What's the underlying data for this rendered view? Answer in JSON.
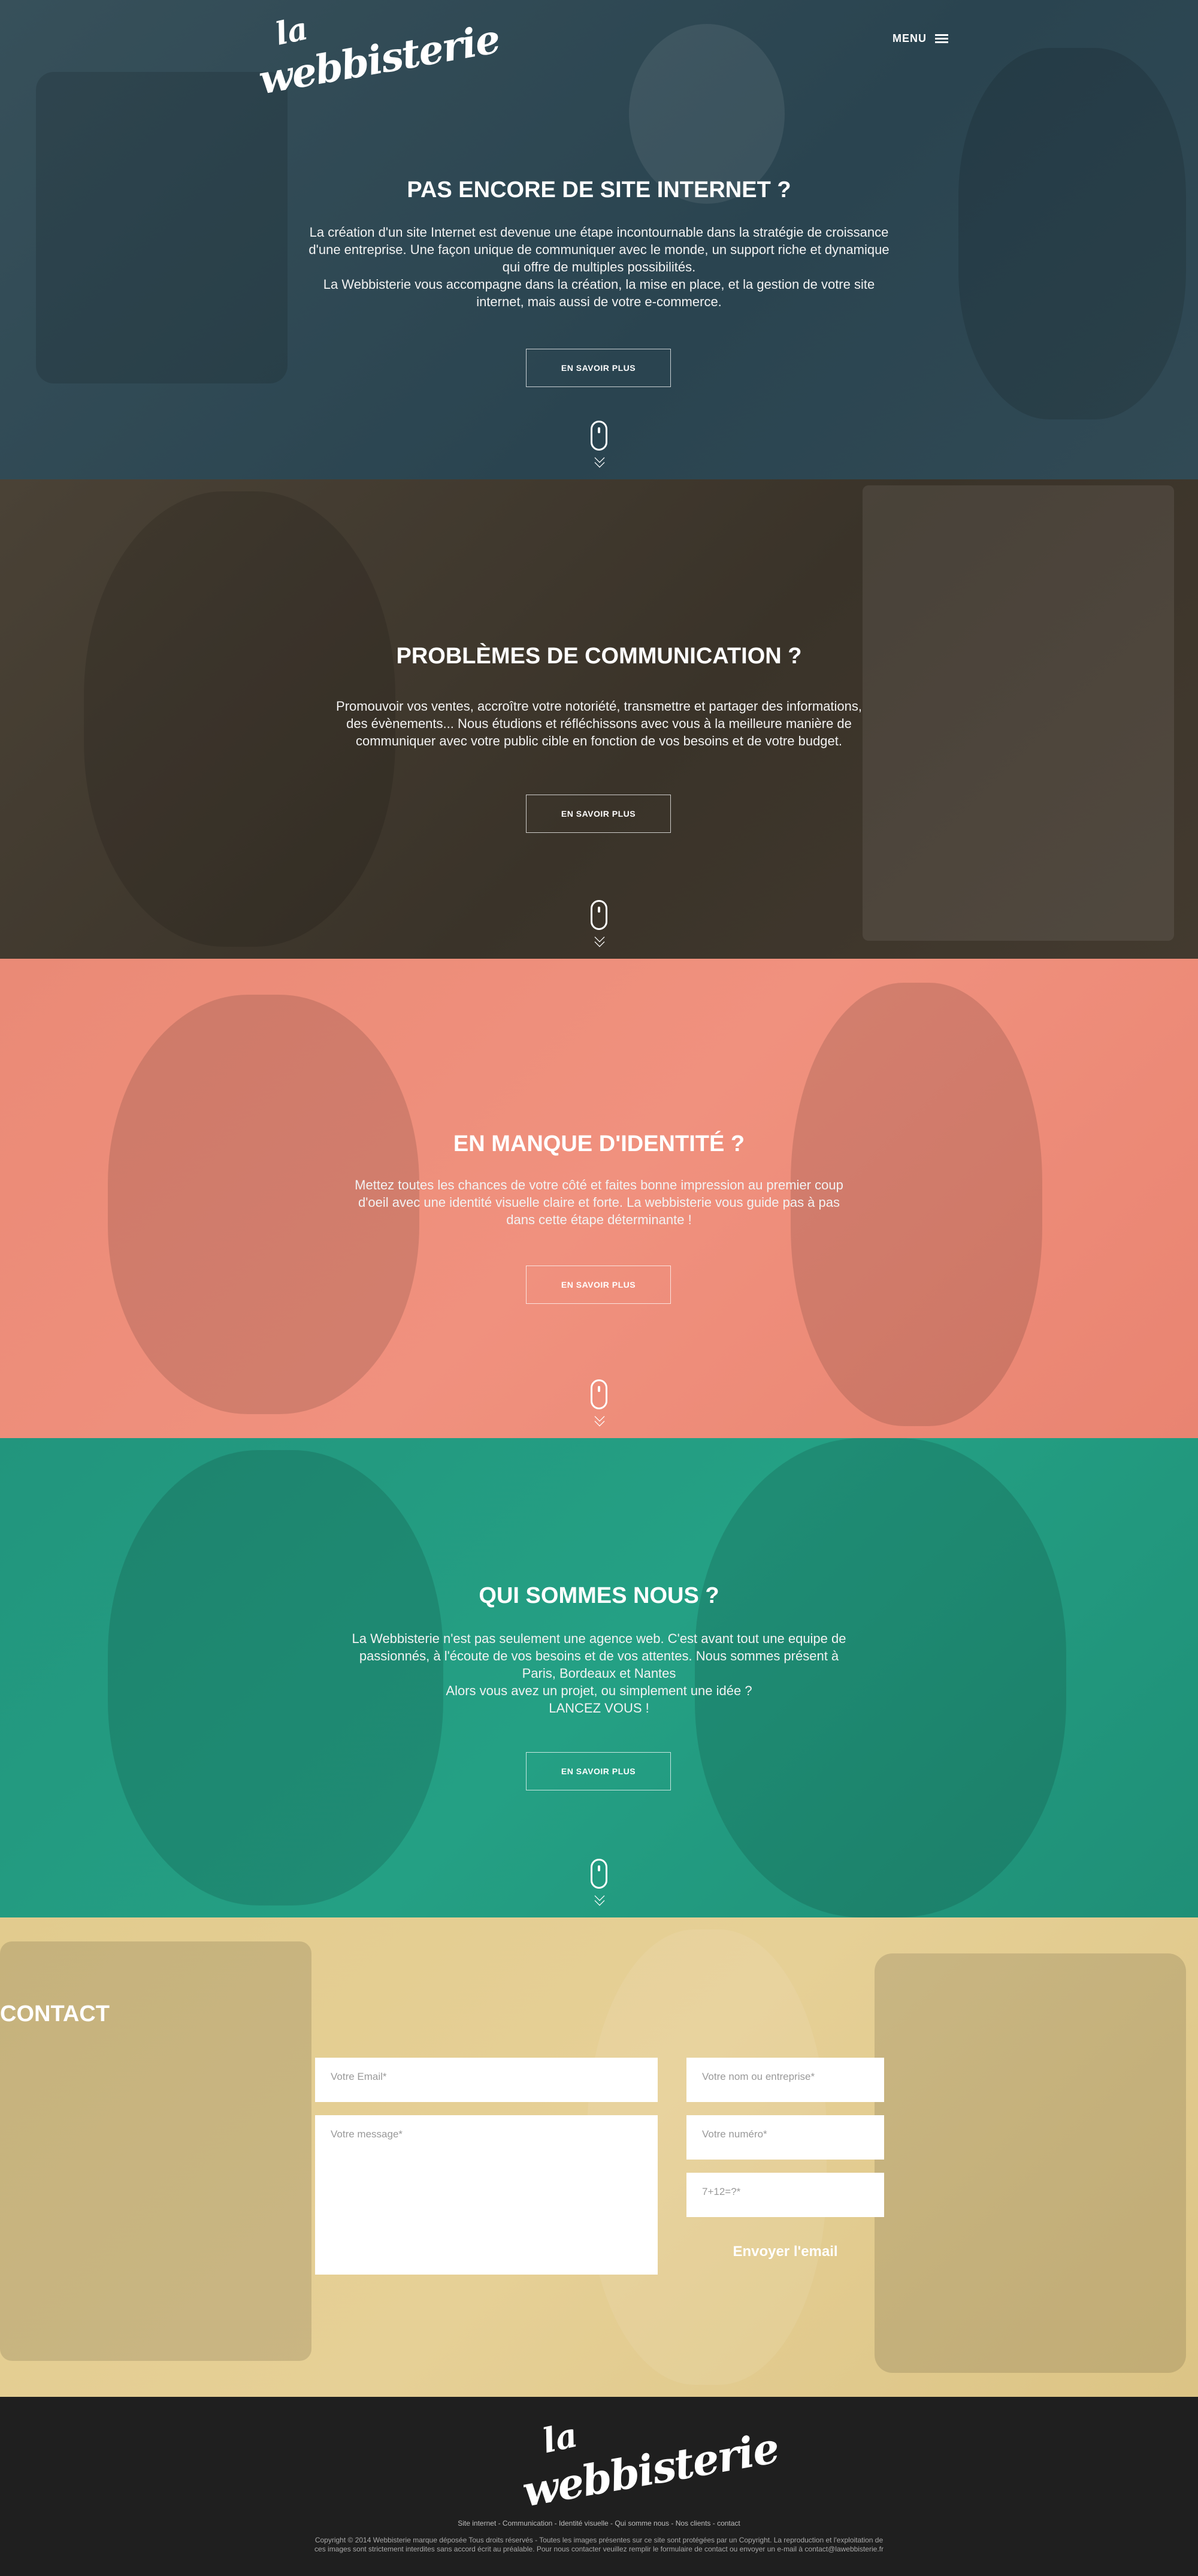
{
  "header": {
    "logo_small": "la",
    "logo_word": "webbisterie",
    "menu_label": "MENU"
  },
  "sections": [
    {
      "title": "PAS ENCORE DE SITE INTERNET ?",
      "text": "La création d'un site Internet est devenue une étape incontournable dans la stratégie de croissance\nd'une entreprise. Une façon unique de communiquer avec le monde, un support riche et dynamique\nqui offre de multiples possibilités.\nLa Webbisterie vous accompagne dans la création, la mise en place, et la gestion de votre site\ninternet, mais aussi de votre e-commerce.",
      "button": "EN SAVOIR PLUS",
      "color": "#2f4a55"
    },
    {
      "title": "PROBLÈMES DE COMMUNICATION ?",
      "text": "Promouvoir vos ventes, accroître votre notoriété, transmettre et partager des informations,\ndes évènements... Nous étudions et réfléchissons avec vous à la meilleure  manière de\ncommuniquer avec votre public cible en fonction de vos besoins et de votre budget.",
      "button": "EN SAVOIR PLUS",
      "color": "#3f372d"
    },
    {
      "title": "EN MANQUE D'IDENTITÉ ?",
      "text": "Mettez toutes les chances de votre côté et faites bonne impression au premier coup\nd'oeil avec une identité visuelle claire et forte. La webbisterie vous guide pas à pas\ndans cette étape déterminante !",
      "button": "EN SAVOIR PLUS",
      "color": "#ee8d79"
    },
    {
      "title": "QUI SOMMES NOUS ?",
      "text": "La Webbisterie n'est pas seulement une agence web. C'est avant tout une equipe de\npassionnés, à l'écoute de vos besoins et de vos attentes. Nous sommes présent à\nParis, Bordeaux et Nantes\nAlors vous avez un projet, ou simplement une idée ?\nLANCEZ VOUS !",
      "button": "EN SAVOIR PLUS",
      "color": "#239c81"
    }
  ],
  "contact": {
    "title": "CONTACT",
    "email_placeholder": "Votre Email*",
    "name_placeholder": "Votre nom ou entreprise*",
    "message_placeholder": "Votre message*",
    "phone_placeholder": "Votre numéro*",
    "captcha_placeholder": "7+12=?*",
    "send_label": "Envoyer l'email",
    "color": "#e4ce92"
  },
  "footer": {
    "logo_small": "la",
    "logo_word": "webbisterie",
    "nav": "Site internet - Communication - Identité visuelle - Qui somme nous - Nos clients - contact",
    "copyright": "Copyright © 2014 Webbisterie marque déposée Tous droits réservés - Toutes les images présentes sur ce site sont protégées par un Copyright. La reproduction et l'exploitation de ces images sont strictement interdites sans accord écrit au préalable. Pour  nous contacter veuillez remplir le formulaire de contact ou envoyer un e-mail à contact@lawebbisterie.fr"
  }
}
